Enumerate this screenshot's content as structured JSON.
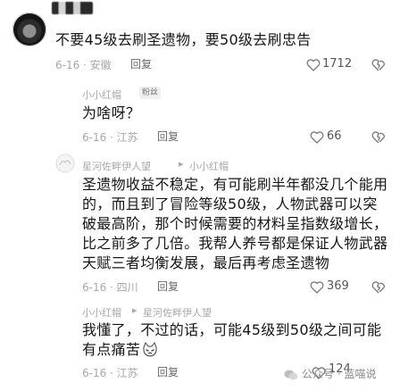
{
  "top_comment": {
    "text": "不要45级去刷圣遗物，要50级去刷忠告",
    "meta": "6-16 · 安徽",
    "reply_label": "回复",
    "likes": "1712"
  },
  "reply1": {
    "user": "小小红帽",
    "badge": "粉丝",
    "text": "为啥呀？",
    "meta": "6-16 · 江苏",
    "reply_label": "回复",
    "likes": "66"
  },
  "reply2": {
    "user": "星河佐畔伊人望",
    "arrow": "▸",
    "target": "小小红帽",
    "lines": [
      "圣遗物收益不稳定，有可能刷半年都没几个能用",
      "的，而且到了冒险等级50级，人物武器可以突",
      "破最高阶，那个时候需要的材料呈指数级增长，",
      "比之前多了几倍。我帮人养号都是保证人物武器",
      "天赋三者均衡发展，最后再考虑圣遗物"
    ],
    "meta": "6-16 · 四川",
    "reply_label": "回复",
    "likes": "369"
  },
  "reply3": {
    "user": "小小红帽",
    "arrow": "▸",
    "target": "星河佐畔伊人望",
    "lines": [
      "我懂了，不过的话，可能45级到50级之间可能",
      "有点痛苦"
    ],
    "meta": "6-16 · 江苏",
    "reply_label": "回复",
    "likes": "124"
  },
  "watermark": "公众号 · 蓝喵说"
}
